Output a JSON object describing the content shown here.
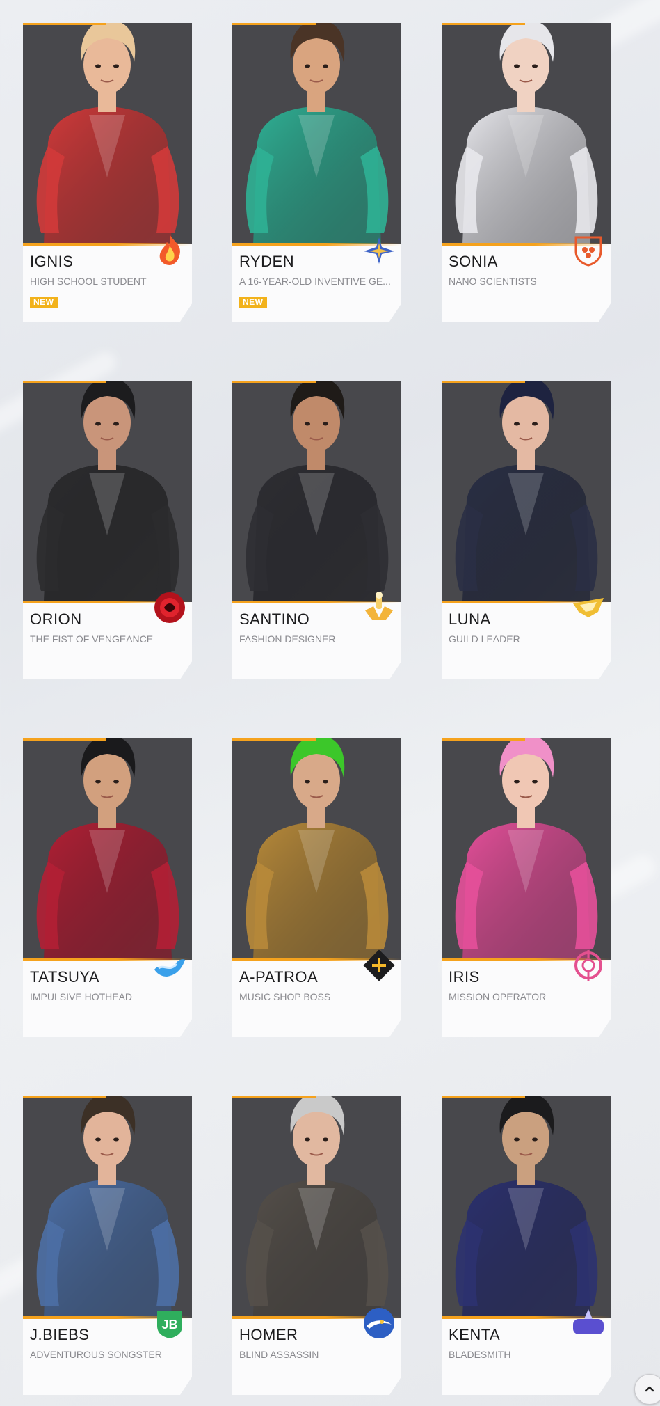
{
  "characters": [
    {
      "name": "IGNIS",
      "description": "HIGH SCHOOL STUDENT",
      "badge": "NEW",
      "emblem": "flame-emblem-icon",
      "color": "#d23a3a",
      "hair": "#e9c79a",
      "skin": "#e9b999"
    },
    {
      "name": "RYDEN",
      "description": "A 16-YEAR-OLD INVENTIVE GE...",
      "badge": "NEW",
      "emblem": "star-wing-emblem-icon",
      "color": "#2fb195",
      "hair": "#4a3426",
      "skin": "#d9a47f"
    },
    {
      "name": "SONIA",
      "description": "NANO SCIENTISTS",
      "badge": "",
      "emblem": "shield-hex-emblem-icon",
      "color": "#e8e8ec",
      "hair": "#e6e6ea",
      "skin": "#f0d2c2"
    },
    {
      "name": "ORION",
      "description": "THE FIST OF VENGEANCE",
      "badge": "",
      "emblem": "red-orb-emblem-icon",
      "color": "#2b2b2e",
      "hair": "#1c1c1e",
      "skin": "#c9957a"
    },
    {
      "name": "SANTINO",
      "description": "FASHION DESIGNER",
      "badge": "",
      "emblem": "trophy-emblem-icon",
      "color": "#2e2e33",
      "hair": "#1f1b18",
      "skin": "#c08a6a"
    },
    {
      "name": "LUNA",
      "description": "GUILD LEADER",
      "badge": "",
      "emblem": "gold-wing-emblem-icon",
      "color": "#2a2f45",
      "hair": "#1e2340",
      "skin": "#e4b9a3"
    },
    {
      "name": "TATSUYA",
      "description": "IMPULSIVE HOTHEAD",
      "badge": "",
      "emblem": "blue-wave-emblem-icon",
      "color": "#b21f35",
      "hair": "#1a1a1c",
      "skin": "#d2a07e"
    },
    {
      "name": "A-PATROA",
      "description": "MUSIC SHOP BOSS",
      "badge": "",
      "emblem": "plus-diamond-emblem-icon",
      "color": "#b88a3a",
      "hair": "#3cc72a",
      "skin": "#d8a989"
    },
    {
      "name": "IRIS",
      "description": "MISSION OPERATOR",
      "badge": "",
      "emblem": "target-emblem-icon",
      "color": "#e6509a",
      "hair": "#f090c8",
      "skin": "#f0c7b4"
    },
    {
      "name": "J.BIEBS",
      "description": "ADVENTUROUS SONGSTER",
      "badge": "",
      "emblem": "jb-monogram-emblem-icon",
      "color": "#4c6fa5",
      "hair": "#3c3026",
      "skin": "#e2b49a"
    },
    {
      "name": "HOMER",
      "description": "BLIND ASSASSIN",
      "badge": "",
      "emblem": "eagle-orb-emblem-icon",
      "color": "#55504a",
      "hair": "#c9c9c9",
      "skin": "#e1b8a0"
    },
    {
      "name": "KENTA",
      "description": "BLADESMITH",
      "badge": "",
      "emblem": "katana-crest-emblem-icon",
      "color": "#2c3270",
      "hair": "#1b1b1d",
      "skin": "#caa07f"
    }
  ],
  "scroll_top": {
    "icon": "chevron-up-icon"
  }
}
